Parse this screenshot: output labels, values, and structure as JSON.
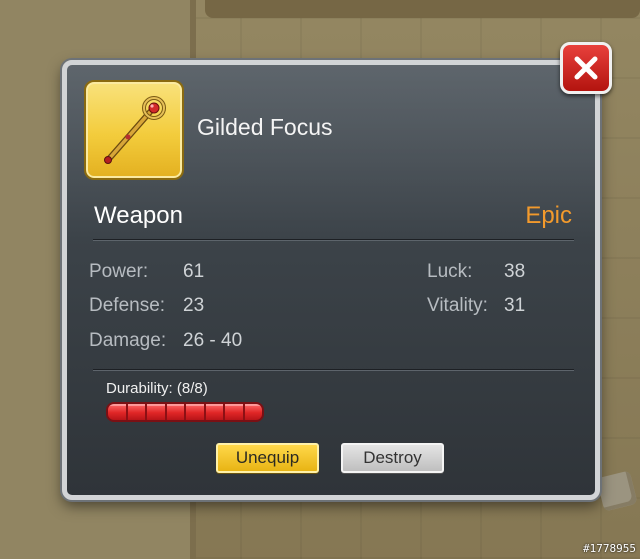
{
  "item": {
    "name": "Gilded Focus",
    "type": "Weapon",
    "rarity": "Epic",
    "icon": "golden-staff-icon"
  },
  "stats": {
    "power_label": "Power:",
    "power_value": "61",
    "defense_label": "Defense:",
    "defense_value": "23",
    "damage_label": "Damage:",
    "damage_value": "26 - 40",
    "luck_label": "Luck:",
    "luck_value": "38",
    "vitality_label": "Vitality:",
    "vitality_value": "31"
  },
  "durability": {
    "label": "Durability: (8/8)",
    "current": 8,
    "max": 8
  },
  "buttons": {
    "unequip": "Unequip",
    "destroy": "Destroy",
    "close": "close-icon"
  },
  "watermark": "#1778955",
  "colors": {
    "rarity_epic": "#f39a2c",
    "icon_gold": "#f3cc3c",
    "durability_red": "#e02626",
    "close_red": "#c9221e"
  }
}
